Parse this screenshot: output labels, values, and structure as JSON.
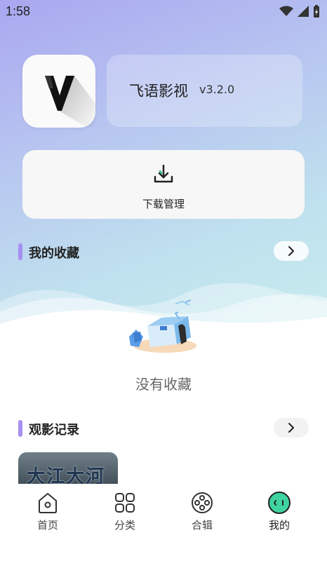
{
  "status": {
    "time": "1:58"
  },
  "app": {
    "name": "飞语影视",
    "version": "v3.2.0"
  },
  "download": {
    "label": "下载管理"
  },
  "favorites": {
    "title": "我的收藏",
    "empty_text": "没有收藏"
  },
  "history": {
    "title": "观影记录",
    "items": [
      {
        "title": "大江大河"
      }
    ]
  },
  "nav": {
    "items": [
      {
        "label": "首页",
        "icon": "home-icon"
      },
      {
        "label": "分类",
        "icon": "grid-icon"
      },
      {
        "label": "合辑",
        "icon": "film-reel-icon"
      },
      {
        "label": "我的",
        "icon": "profile-face-icon"
      }
    ],
    "active_index": 3
  },
  "colors": {
    "accent": "#a78ff0",
    "active_nav": "#3fd3a0",
    "download_icon_green": "#2cc48a"
  }
}
